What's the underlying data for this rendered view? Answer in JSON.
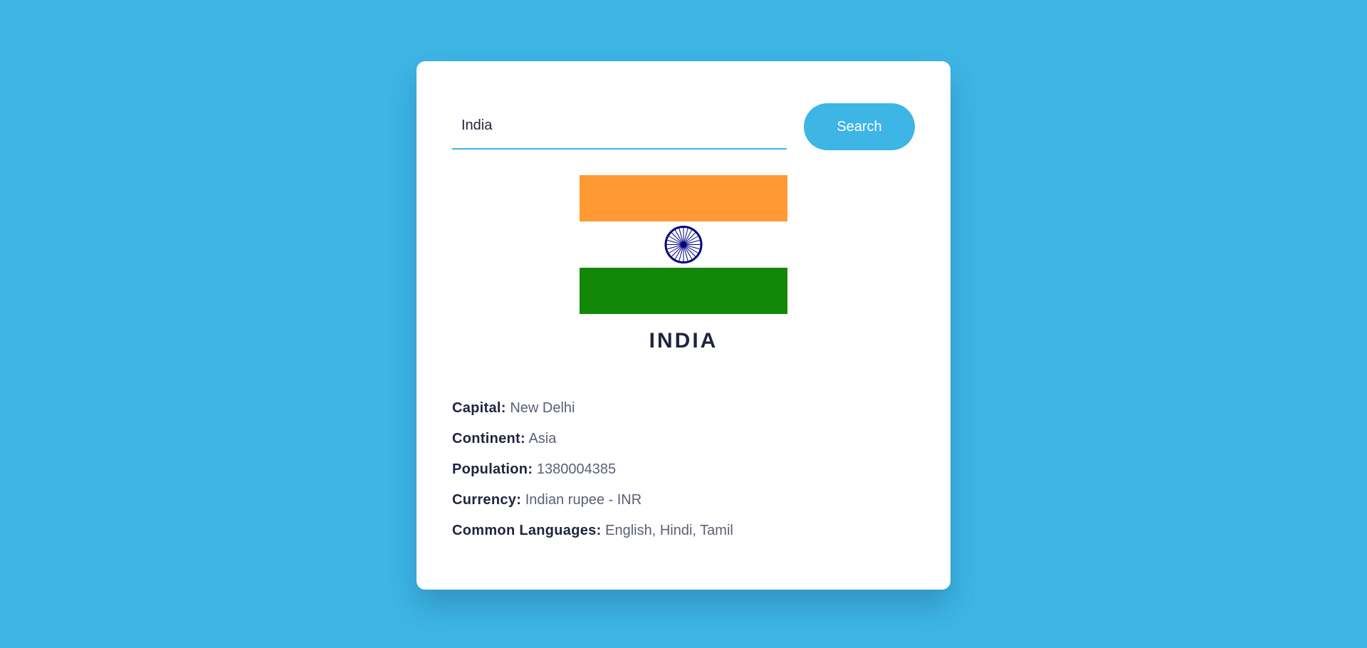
{
  "search": {
    "value": "India",
    "button_label": "Search"
  },
  "flag": {
    "colors": {
      "saffron": "#ff9933",
      "white": "#ffffff",
      "green": "#138808",
      "chakra": "#000080"
    }
  },
  "country": {
    "name": "INDIA"
  },
  "details": [
    {
      "label": "Capital:",
      "value": "New Delhi"
    },
    {
      "label": "Continent:",
      "value": "Asia"
    },
    {
      "label": "Population:",
      "value": "1380004385"
    },
    {
      "label": "Currency:",
      "value": "Indian rupee - INR"
    },
    {
      "label": "Common Languages:",
      "value": "English, Hindi, Tamil"
    }
  ],
  "theme": {
    "accent": "#3db5e5",
    "text_dark": "#1f2340",
    "text_muted": "#5b6078"
  }
}
